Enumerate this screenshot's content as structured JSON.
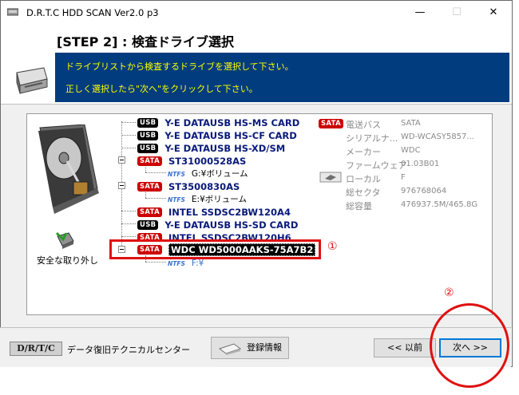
{
  "window": {
    "title": "D.R.T.C HDD SCAN Ver2.0 p3",
    "minimize": "—",
    "maximize": "☐",
    "close": "✕"
  },
  "header": {
    "step_title": "[STEP 2] : 検査ドライブ選択",
    "instruction_1": "ドライブリストから検査するドライブを選択して下さい。",
    "instruction_2": "正しく選択したら\"次へ\"をクリックして下さい。"
  },
  "left": {
    "safe_remove": "安全な取り外し"
  },
  "drives": [
    {
      "bus": "USB",
      "name": "Y-E DATAUSB   HS-MS CARD"
    },
    {
      "bus": "USB",
      "name": "Y-E DATAUSB   HS-CF CARD"
    },
    {
      "bus": "USB",
      "name": "Y-E DATAUSB   HS-XD/SM"
    },
    {
      "bus": "SATA",
      "name": "ST31000528AS",
      "partition": {
        "fs": "NTFS",
        "label": "G:¥ボリューム"
      }
    },
    {
      "bus": "SATA",
      "name": "ST3500830AS",
      "partition": {
        "fs": "NTFS",
        "label": "E:¥ボリューム"
      }
    },
    {
      "bus": "SATA",
      "name": "INTEL SSDSC2BW120A4"
    },
    {
      "bus": "USB",
      "name": "Y-E DATAUSB   HS-SD CARD"
    },
    {
      "bus": "SATA",
      "name": "INTEL SSDSC2BW120H6"
    },
    {
      "bus": "SATA",
      "name": "WDC WD5000AAKS-75A7B2",
      "selected": true,
      "partition": {
        "fs": "NTFS",
        "label": "F:¥"
      }
    }
  ],
  "properties": {
    "bus_badge": "SATA",
    "rows": [
      {
        "label": "電送バス",
        "value": "SATA"
      },
      {
        "label": "シリアルナ...",
        "value": "WD-WCASY5857..."
      },
      {
        "label": "メーカー",
        "value": "WDC"
      },
      {
        "label": "ファームウェア",
        "value": "01.03B01"
      },
      {
        "label": "ローカル",
        "value": "F"
      },
      {
        "label": "総セクタ",
        "value": "976768064"
      },
      {
        "label": "総容量",
        "value": "476937.5M/465.8G"
      }
    ]
  },
  "annotations": {
    "one": "①",
    "two": "②"
  },
  "footer": {
    "logo": "D/R/T/C",
    "company": "データ復旧テクニカルセンター",
    "register_button": "登録情報",
    "back_button": "<< 以前",
    "next_button": "次へ >>"
  },
  "colors": {
    "info_bg": "#003c7e",
    "info_text": "#ffff00",
    "drive_text": "#0a1a7a",
    "sata_badge": "#cc0000",
    "usb_badge": "#000000",
    "annotation": "#e01010"
  }
}
